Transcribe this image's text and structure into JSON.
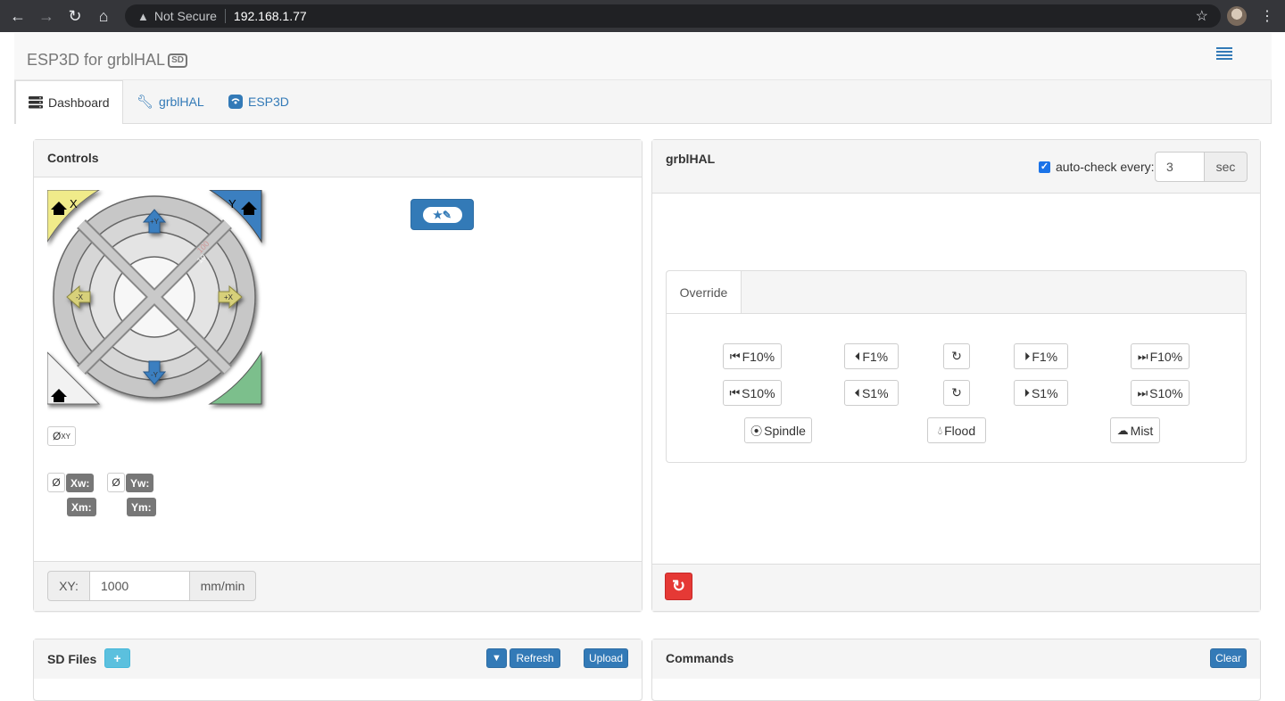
{
  "browser": {
    "security_label": "Not Secure",
    "url": "192.168.1.77"
  },
  "navbar": {
    "brand": "ESP3D for grblHAL",
    "brand_badge": "SD"
  },
  "tabs": [
    {
      "label": "Dashboard",
      "active": true
    },
    {
      "label": "grblHAL",
      "active": false
    },
    {
      "label": "ESP3D",
      "active": false
    }
  ],
  "controls": {
    "title": "Controls",
    "jog": {
      "home_x": "X",
      "home_y": "Y",
      "plus_y": "+Y",
      "minus_y": "-Y",
      "plus_x": "+X",
      "minus_x": "-X",
      "steps": [
        "100",
        "10",
        "1",
        "0.1"
      ]
    },
    "zero_xy_label": "Ø",
    "zero_xy_sub": "XY",
    "zero_x_label": "Ø",
    "zero_y_label": "Ø",
    "xw_label": "Xw:",
    "yw_label": "Yw:",
    "xm_label": "Xm:",
    "ym_label": "Ym:",
    "feed_label": "XY:",
    "feed_value": "1000",
    "feed_unit": "mm/min"
  },
  "grbl_panel": {
    "title": "grblHAL",
    "autocheck_label": "auto-check every:",
    "autocheck_checked": true,
    "autocheck_value": "3",
    "autocheck_unit": "sec",
    "override_tab": "Override",
    "feed_row": [
      "F10%",
      "F1%",
      "F1%",
      "F10%"
    ],
    "spindle_row": [
      "S10%",
      "S1%",
      "S1%",
      "S10%"
    ],
    "coolant": [
      "Spindle",
      "Flood",
      "Mist"
    ]
  },
  "sd_panel": {
    "title": "SD Files",
    "refresh_label": "Refresh",
    "upload_label": "Upload"
  },
  "commands_panel": {
    "title": "Commands",
    "clear_label": "Clear"
  },
  "colors": {
    "primary": "#337ab7",
    "home_x": "#f0eb8a",
    "home_y": "#3b7fc0",
    "home_z": "#7cbf8c",
    "danger": "#e53935"
  }
}
